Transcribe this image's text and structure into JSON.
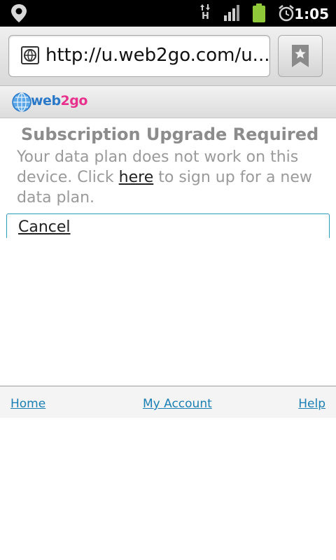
{
  "status_bar": {
    "time": "1:05",
    "network_type": "H",
    "icons": [
      "location-pin-icon",
      "data-transfer-icon",
      "signal-icon",
      "battery-icon",
      "alarm-clock-icon"
    ]
  },
  "browser": {
    "url": "http://u.web2go.com/u...",
    "icons": [
      "globe-icon",
      "bookmark-star-icon"
    ]
  },
  "site": {
    "logo_text_part1": "web",
    "logo_text_part2": "2go",
    "colors": {
      "logo_blue": "#2a78c8",
      "logo_pink": "#e8308c",
      "link": "#1a7fb4",
      "focus_border": "#2aa0b8"
    }
  },
  "content": {
    "title": "Subscription Upgrade Required",
    "message_before": "Your data plan does not work on this device. Click ",
    "message_link": "here",
    "message_after": " to sign up for a new data plan.",
    "cancel_label": "Cancel"
  },
  "footer": {
    "home": "Home",
    "my_account": "My Account",
    "help": "Help"
  }
}
